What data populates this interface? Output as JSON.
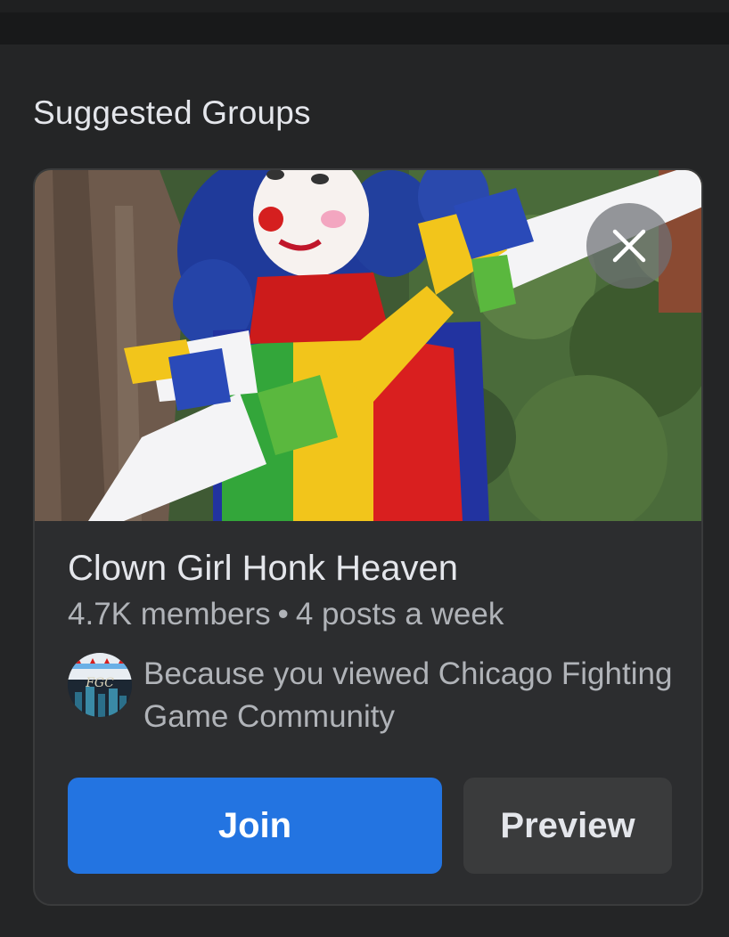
{
  "section": {
    "title": "Suggested Groups"
  },
  "group": {
    "name": "Clown Girl Honk Heaven",
    "members": "4.7K members",
    "separator": "•",
    "activity": "4 posts a week",
    "reason": "Because you viewed Chicago Fighting Game Community",
    "reason_avatar_label": "FGC",
    "cover_icon": "clown-cosplay-photo",
    "dismiss_icon": "close-icon"
  },
  "actions": {
    "join_label": "Join",
    "preview_label": "Preview"
  },
  "colors": {
    "background": "#242526",
    "card": "#2c2d2f",
    "primary_button": "#2374e1",
    "secondary_button": "#3a3b3c",
    "primary_text": "#e4e6eb",
    "secondary_text": "#b0b3b8"
  }
}
